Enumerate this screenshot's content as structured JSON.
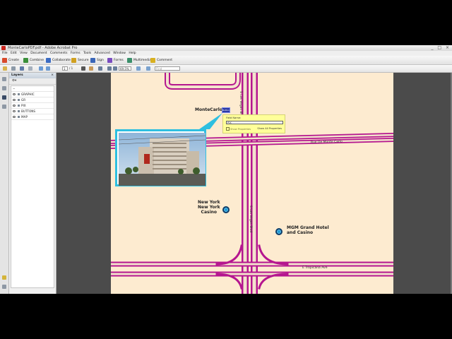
{
  "window": {
    "title": "MonteCarloPDF.pdf - Adobe Acrobat Pro",
    "controls": "_ □ ×"
  },
  "menu": [
    "File",
    "Edit",
    "View",
    "Document",
    "Comments",
    "Forms",
    "Tools",
    "Advanced",
    "Window",
    "Help"
  ],
  "tasks": [
    {
      "label": "Create",
      "color": "#d84a2b"
    },
    {
      "label": "Combine",
      "color": "#3a8f3a"
    },
    {
      "label": "Collaborate",
      "color": "#3b6cc4"
    },
    {
      "label": "Secure",
      "color": "#d0a020"
    },
    {
      "label": "Sign",
      "color": "#3a66b8"
    },
    {
      "label": "Forms",
      "color": "#7a4cc0"
    },
    {
      "label": "Multimedia",
      "color": "#3a8f6a"
    },
    {
      "label": "Comment",
      "color": "#d8b020"
    }
  ],
  "toolbar": {
    "page_current": "1",
    "page_total": "/ 1",
    "zoom": "69.5%",
    "find_placeholder": "Find"
  },
  "layers_panel": {
    "title": "Layers",
    "options": "Options",
    "items": [
      {
        "name": "",
        "root": true
      },
      {
        "name": "GRAPHIC",
        "root": false
      },
      {
        "name": "GR",
        "root": false
      },
      {
        "name": "PIX",
        "root": false
      },
      {
        "name": "BUTTONS",
        "root": false
      },
      {
        "name": "MAP",
        "root": false
      }
    ]
  },
  "map": {
    "labels": {
      "monte_carlo": "MonteCarlo",
      "new_york": "New York\nNew York\nCasino",
      "mgm": "MGM Grand Hotel\nand Casino"
    },
    "streets": {
      "las_vegas_blvd_top": "S Las Vegas Blvd",
      "las_vegas_blvd_mid": "S Las Vegas Blvd",
      "rue_de_monte_carlo": "Rue De Monte Carlo",
      "tropicana": "E Tropicana Ave"
    },
    "colors": {
      "background": "#fdebd0",
      "road": "#b5168f",
      "road_fill": "#f3e3cc",
      "marker": "#1e9bd7"
    },
    "field_tag": "Button1",
    "popup": {
      "label": "Field Name:",
      "value": "PIX",
      "checkbox": "Show Properties",
      "link": "Show All Properties"
    }
  }
}
